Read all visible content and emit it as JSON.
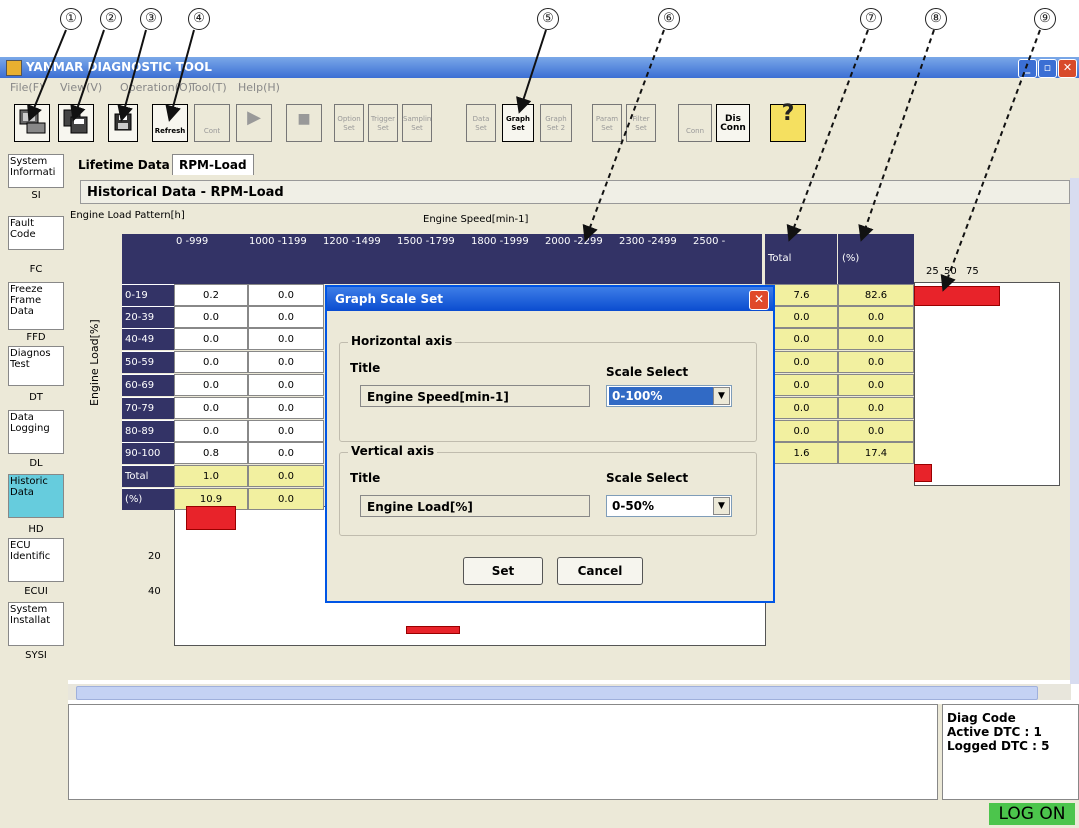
{
  "callouts": [
    "①",
    "②",
    "③",
    "④",
    "⑤",
    "⑥",
    "⑦",
    "⑧",
    "⑨"
  ],
  "window": {
    "title": "YANMAR DIAGNOSTIC TOOL",
    "min": "_",
    "restore": "▫",
    "close": "✕"
  },
  "menu": [
    "File(F)",
    "View(V)",
    "Operation(O)",
    "Tool(T)",
    "Help(H)"
  ],
  "toolbar": {
    "refresh": "Refresh",
    "cont": "Cont",
    "play": "▶",
    "stop": "■",
    "option_set": "Option Set",
    "trigger_set": "Trigger Set",
    "sampling_set": "Samplin Set",
    "data_set": "Data Set",
    "graph_set": "Graph Set",
    "graph_set2": "Graph Set 2",
    "param_set": "Param Set",
    "filter_set": "Filter Set",
    "conn": "Conn",
    "disconn": "Dis Conn",
    "help": "?"
  },
  "nav": [
    {
      "label": "System Informati",
      "code": "SI"
    },
    {
      "label": "Fault Code",
      "code": "FC"
    },
    {
      "label": "Freeze Frame Data",
      "code": "FFD"
    },
    {
      "label": "Diagnos Test",
      "code": "DT"
    },
    {
      "label": "Data Logging",
      "code": "DL"
    },
    {
      "label": "Historic Data",
      "code": "HD"
    },
    {
      "label": "ECU Identific",
      "code": "ECUI"
    },
    {
      "label": "System Installat",
      "code": "SYSI"
    }
  ],
  "tabs": [
    "Lifetime Data",
    "RPM-Load"
  ],
  "content": {
    "title": "Historical Data - RPM-Load",
    "pattern_label": "Engine Load Pattern[h]",
    "speed_label": "Engine Speed[min-1]",
    "load_label": "Engine Load[%]",
    "col_headers": [
      "0 -999",
      "1000 -1199",
      "1200 -1499",
      "1500 -1799",
      "1800 -1999",
      "2000 -2299",
      "2300 -2499",
      "2500 -"
    ],
    "total_header": "Total",
    "pct_header": "(%)",
    "axis_ticks": [
      "25",
      "50",
      "75"
    ],
    "row_labels": [
      "0-19",
      "20-39",
      "40-49",
      "50-59",
      "60-69",
      "70-79",
      "80-89",
      "90-100",
      "Total",
      "(%)"
    ],
    "col0": [
      "0.2",
      "0.0",
      "0.0",
      "0.0",
      "0.0",
      "0.0",
      "0.0",
      "0.8",
      "1.0",
      "10.9"
    ],
    "col1": [
      "0.0",
      "0.0",
      "0.0",
      "0.0",
      "0.0",
      "0.0",
      "0.0",
      "0.0",
      "0.0",
      "0.0"
    ],
    "totals": [
      "7.6",
      "0.0",
      "0.0",
      "0.0",
      "0.0",
      "0.0",
      "0.0",
      "1.6"
    ],
    "percents": [
      "82.6",
      "0.0",
      "0.0",
      "0.0",
      "0.0",
      "0.0",
      "0.0",
      "17.4"
    ],
    "lower_ticks": [
      "20",
      "40"
    ]
  },
  "dialog": {
    "title": "Graph Scale Set",
    "h_group": "Horizontal axis",
    "v_group": "Vertical axis",
    "title_lbl": "Title",
    "scale_lbl": "Scale Select",
    "h_title": "Engine Speed[min-1]",
    "h_scale": "0-100%",
    "v_title": "Engine Load[%]",
    "v_scale": "0-50%",
    "set": "Set",
    "cancel": "Cancel",
    "close": "✕"
  },
  "diag": {
    "code": "Diag Code",
    "active": "Active DTC : 1",
    "logged": "Logged DTC : 5"
  },
  "status": {
    "logon": "LOG ON"
  }
}
